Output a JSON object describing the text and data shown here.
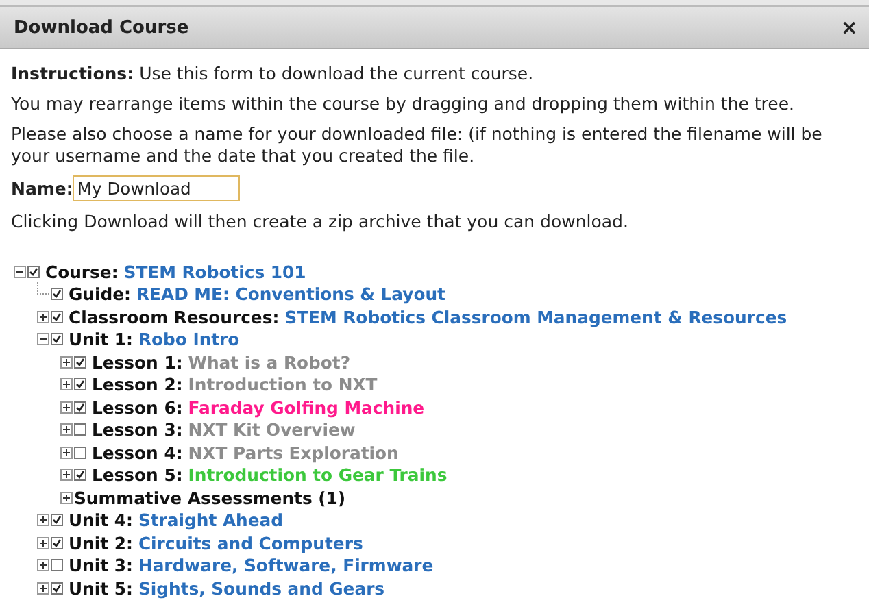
{
  "dialog": {
    "title": "Download Course",
    "close": "×"
  },
  "instructions": [
    {
      "text": "**Instructions:** Use this form to download the current course."
    },
    {
      "text": "You may rearrange items within the course by dragging and dropping them within the tree."
    },
    {
      "text": "Please also choose a name for your downloaded file: (if nothing is entered the filename will be your username and the date that you created the file."
    }
  ],
  "name_field": {
    "label": "Name:",
    "value": "My Download"
  },
  "note": "Clicking Download will then create a zip archive that you can download.",
  "tree": [
    {
      "label": "Course:",
      "title": "STEM Robotics 101",
      "color": "#2a6ebb",
      "checked": true,
      "expanded": true,
      "children": [
        {
          "label": "Guide:",
          "title": "READ ME: Conventions & Layout",
          "color": "#2a6ebb",
          "checked": true
        },
        {
          "label": "Classroom Resources:",
          "title": "STEM Robotics Classroom Management & Resources",
          "color": "#2a6ebb",
          "checked": true,
          "expanded": false
        },
        {
          "label": "Unit 1:",
          "title": "Robo Intro",
          "color": "#2a6ebb",
          "checked": true,
          "expanded": true,
          "children": [
            {
              "label": "Lesson 1:",
              "title": "What is a Robot?",
              "color": "#8c8c8c",
              "checked": true,
              "expanded": false
            },
            {
              "label": "Lesson 2:",
              "title": "Introduction to NXT",
              "color": "#8c8c8c",
              "checked": true,
              "expanded": false
            },
            {
              "label": "Lesson 6:",
              "title": "Faraday Golfing Machine",
              "color": "#ff1a8c",
              "checked": true,
              "expanded": false
            },
            {
              "label": "Lesson 3:",
              "title": "NXT Kit Overview",
              "color": "#8c8c8c",
              "checked": false,
              "expanded": false
            },
            {
              "label": "Lesson 4:",
              "title": "NXT Parts Exploration",
              "color": "#8c8c8c",
              "checked": false,
              "expanded": false
            },
            {
              "label": "Lesson 5:",
              "title": "Introduction to Gear Trains",
              "color": "#3cc83c",
              "checked": true,
              "expanded": false
            },
            {
              "label": "Summative Assessments (1)",
              "expanded": false
            }
          ]
        },
        {
          "label": "Unit 4:",
          "title": "Straight Ahead",
          "color": "#2a6ebb",
          "checked": true,
          "expanded": false
        },
        {
          "label": "Unit 2:",
          "title": "Circuits and Computers",
          "color": "#2a6ebb",
          "checked": true,
          "expanded": false
        },
        {
          "label": "Unit 3:",
          "title": "Hardware, Software, Firmware",
          "color": "#2a6ebb",
          "checked": false,
          "expanded": false
        },
        {
          "label": "Unit 5:",
          "title": "Sights, Sounds and Gears",
          "color": "#2a6ebb",
          "checked": true,
          "expanded": false
        }
      ]
    }
  ]
}
